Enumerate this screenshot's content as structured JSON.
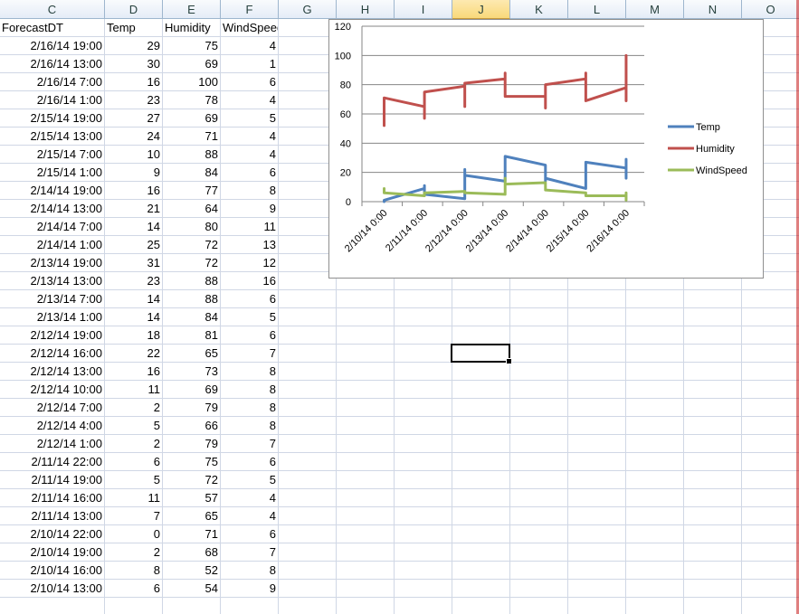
{
  "columns": [
    "C",
    "D",
    "E",
    "F",
    "G",
    "H",
    "I",
    "J",
    "K",
    "L",
    "M",
    "N",
    "O"
  ],
  "selected_column": "J",
  "table": {
    "headers": [
      "ForecastDT",
      "Temp",
      "Humidity",
      "WindSpeed"
    ],
    "rows": [
      [
        "2/16/14 19:00",
        "29",
        "75",
        "4"
      ],
      [
        "2/16/14 13:00",
        "30",
        "69",
        "1"
      ],
      [
        "2/16/14 7:00",
        "16",
        "100",
        "6"
      ],
      [
        "2/16/14 1:00",
        "23",
        "78",
        "4"
      ],
      [
        "2/15/14 19:00",
        "27",
        "69",
        "5"
      ],
      [
        "2/15/14 13:00",
        "24",
        "71",
        "4"
      ],
      [
        "2/15/14 7:00",
        "10",
        "88",
        "4"
      ],
      [
        "2/15/14 1:00",
        "9",
        "84",
        "6"
      ],
      [
        "2/14/14 19:00",
        "16",
        "77",
        "8"
      ],
      [
        "2/14/14 13:00",
        "21",
        "64",
        "9"
      ],
      [
        "2/14/14 7:00",
        "14",
        "80",
        "11"
      ],
      [
        "2/14/14 1:00",
        "25",
        "72",
        "13"
      ],
      [
        "2/13/14 19:00",
        "31",
        "72",
        "12"
      ],
      [
        "2/13/14 13:00",
        "23",
        "88",
        "16"
      ],
      [
        "2/13/14 7:00",
        "14",
        "88",
        "6"
      ],
      [
        "2/13/14 1:00",
        "14",
        "84",
        "5"
      ],
      [
        "2/12/14 19:00",
        "18",
        "81",
        "6"
      ],
      [
        "2/12/14 16:00",
        "22",
        "65",
        "7"
      ],
      [
        "2/12/14 13:00",
        "16",
        "73",
        "8"
      ],
      [
        "2/12/14 10:00",
        "11",
        "69",
        "8"
      ],
      [
        "2/12/14 7:00",
        "2",
        "79",
        "8"
      ],
      [
        "2/12/14 4:00",
        "5",
        "66",
        "8"
      ],
      [
        "2/12/14 1:00",
        "2",
        "79",
        "7"
      ],
      [
        "2/11/14 22:00",
        "6",
        "75",
        "6"
      ],
      [
        "2/11/14 19:00",
        "5",
        "72",
        "5"
      ],
      [
        "2/11/14 16:00",
        "11",
        "57",
        "4"
      ],
      [
        "2/11/14 13:00",
        "7",
        "65",
        "4"
      ],
      [
        "2/10/14 22:00",
        "0",
        "71",
        "6"
      ],
      [
        "2/10/14 19:00",
        "2",
        "68",
        "7"
      ],
      [
        "2/10/14 16:00",
        "8",
        "52",
        "8"
      ],
      [
        "2/10/14 13:00",
        "6",
        "54",
        "9"
      ]
    ]
  },
  "chart_data": {
    "type": "line",
    "x_dates": [
      "2/10/14 0:00",
      "2/11/14 0:00",
      "2/12/14 0:00",
      "2/13/14 0:00",
      "2/14/14 0:00",
      "2/15/14 0:00",
      "2/16/14 0:00"
    ],
    "ylim": [
      0,
      120
    ],
    "yticks": [
      "0",
      "20",
      "40",
      "60",
      "80",
      "100",
      "120"
    ],
    "grid": true,
    "legend_position": "right",
    "series": [
      {
        "name": "Temp",
        "color": "#4f81bd",
        "points": [
          [
            0,
            0
          ],
          [
            0,
            1
          ],
          [
            1,
            9
          ],
          [
            1,
            7
          ],
          [
            1,
            11
          ],
          [
            1,
            5
          ],
          [
            2,
            2
          ],
          [
            2,
            5
          ],
          [
            2,
            22
          ],
          [
            2,
            18
          ],
          [
            3,
            14
          ],
          [
            3,
            31
          ],
          [
            4,
            25
          ],
          [
            4,
            14
          ],
          [
            4,
            16
          ],
          [
            5,
            9
          ],
          [
            5,
            10
          ],
          [
            5,
            27
          ],
          [
            6,
            23
          ],
          [
            6,
            29
          ],
          [
            6,
            16
          ]
        ]
      },
      {
        "name": "Humidity",
        "color": "#c0504d",
        "points": [
          [
            0,
            52
          ],
          [
            0,
            71
          ],
          [
            1,
            65
          ],
          [
            1,
            57
          ],
          [
            1,
            75
          ],
          [
            2,
            79
          ],
          [
            2,
            65
          ],
          [
            2,
            81
          ],
          [
            3,
            84
          ],
          [
            3,
            88
          ],
          [
            3,
            72
          ],
          [
            4,
            72
          ],
          [
            4,
            64
          ],
          [
            4,
            80
          ],
          [
            5,
            84
          ],
          [
            5,
            88
          ],
          [
            5,
            69
          ],
          [
            6,
            78
          ],
          [
            6,
            69
          ],
          [
            6,
            100
          ]
        ]
      },
      {
        "name": "WindSpeed",
        "color": "#9bbb59",
        "points": [
          [
            0,
            9
          ],
          [
            0,
            6
          ],
          [
            1,
            4
          ],
          [
            1,
            6
          ],
          [
            2,
            7
          ],
          [
            2,
            6
          ],
          [
            3,
            5
          ],
          [
            3,
            16
          ],
          [
            3,
            12
          ],
          [
            4,
            13
          ],
          [
            4,
            8
          ],
          [
            5,
            6
          ],
          [
            5,
            4
          ],
          [
            6,
            4
          ],
          [
            6,
            1
          ],
          [
            6,
            6
          ]
        ]
      }
    ]
  }
}
